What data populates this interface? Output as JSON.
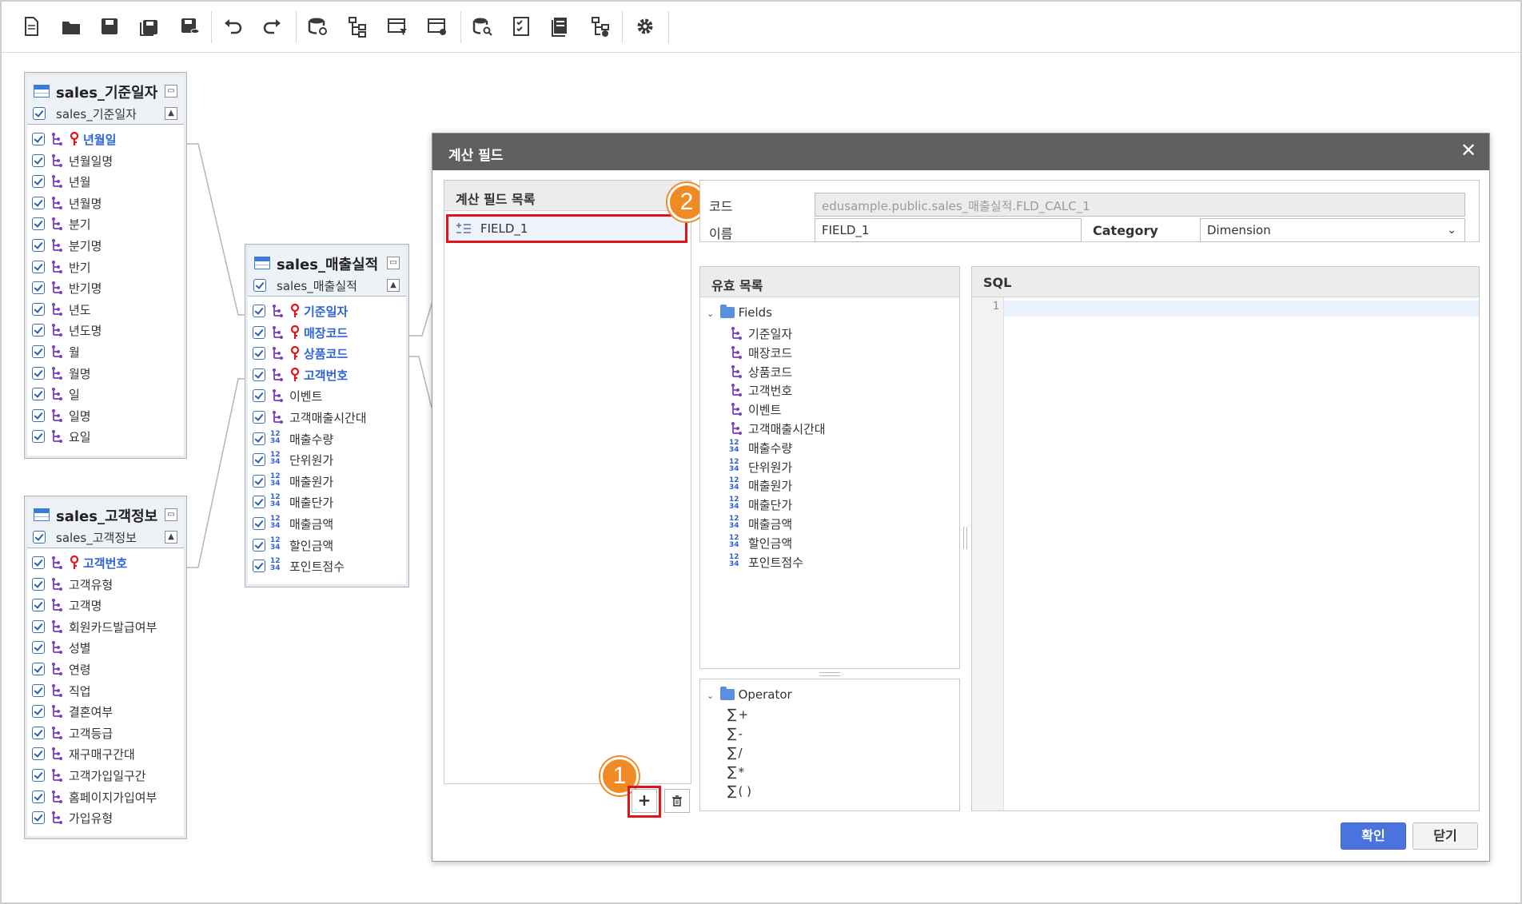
{
  "toolbar": {
    "buttons": [
      "new-icon",
      "open-folder-icon",
      "save-icon",
      "save-as-icon",
      "save-database-icon",
      "undo-icon",
      "redo-icon",
      "database-link-icon",
      "hierarchy-icon",
      "table-filter-icon",
      "table-settings-icon",
      "database-search-icon",
      "checklist-icon",
      "document-icon",
      "hierarchy-settings-icon",
      "gear-icon"
    ]
  },
  "entities": {
    "date": {
      "title": "sales_기준일자",
      "subtitle": "sales_기준일자",
      "fields": [
        {
          "label": "년월일",
          "key": true
        },
        {
          "label": "년월일명"
        },
        {
          "label": "년월"
        },
        {
          "label": "년월명"
        },
        {
          "label": "분기"
        },
        {
          "label": "분기명"
        },
        {
          "label": "반기"
        },
        {
          "label": "반기명"
        },
        {
          "label": "년도"
        },
        {
          "label": "년도명"
        },
        {
          "label": "월"
        },
        {
          "label": "월명"
        },
        {
          "label": "일"
        },
        {
          "label": "일명"
        },
        {
          "label": "요일"
        }
      ]
    },
    "customer": {
      "title": "sales_고객정보",
      "subtitle": "sales_고객정보",
      "fields": [
        {
          "label": "고객번호",
          "key": true
        },
        {
          "label": "고객유형"
        },
        {
          "label": "고객명"
        },
        {
          "label": "회원카드발급여부"
        },
        {
          "label": "성별"
        },
        {
          "label": "연령"
        },
        {
          "label": "직업"
        },
        {
          "label": "결혼여부"
        },
        {
          "label": "고객등급"
        },
        {
          "label": "재구매구간대"
        },
        {
          "label": "고객가입일구간"
        },
        {
          "label": "홈페이지가입여부"
        },
        {
          "label": "가입유형"
        }
      ]
    },
    "sales": {
      "title": "sales_매출실적",
      "subtitle": "sales_매출실적",
      "fields": [
        {
          "label": "기준일자",
          "key": true,
          "type": "dim"
        },
        {
          "label": "매장코드",
          "key": true,
          "type": "dim"
        },
        {
          "label": "상품코드",
          "key": true,
          "type": "dim"
        },
        {
          "label": "고객번호",
          "key": true,
          "type": "dim"
        },
        {
          "label": "이벤트",
          "type": "dim"
        },
        {
          "label": "고객매출시간대",
          "type": "dim"
        },
        {
          "label": "매출수량",
          "type": "num"
        },
        {
          "label": "단위원가",
          "type": "num"
        },
        {
          "label": "매출원가",
          "type": "num"
        },
        {
          "label": "매출단가",
          "type": "num"
        },
        {
          "label": "매출금액",
          "type": "num"
        },
        {
          "label": "할인금액",
          "type": "num"
        },
        {
          "label": "포인트점수",
          "type": "num"
        }
      ]
    }
  },
  "dialog": {
    "title": "계산 필드",
    "close": "✕",
    "calc_list": {
      "header": "계산 필드 목록",
      "items": [
        "FIELD_1"
      ]
    },
    "badges": {
      "one": "1",
      "two": "2"
    },
    "add_button": "+",
    "form": {
      "code_label": "코드",
      "code_value": "edusample.public.sales_매출실적.FLD_CALC_1",
      "name_label": "이름",
      "name_value": "FIELD_1",
      "category_label": "Category",
      "category_value": "Dimension"
    },
    "valid_list": {
      "header": "유효 목록",
      "folder": "Fields",
      "fields": [
        {
          "label": "기준일자",
          "type": "dim"
        },
        {
          "label": "매장코드",
          "type": "dim"
        },
        {
          "label": "상품코드",
          "type": "dim"
        },
        {
          "label": "고객번호",
          "type": "dim"
        },
        {
          "label": "이벤트",
          "type": "dim"
        },
        {
          "label": "고객매출시간대",
          "type": "dim"
        },
        {
          "label": "매출수량",
          "type": "num"
        },
        {
          "label": "단위원가",
          "type": "num"
        },
        {
          "label": "매출원가",
          "type": "num"
        },
        {
          "label": "매출단가",
          "type": "num"
        },
        {
          "label": "매출금액",
          "type": "num"
        },
        {
          "label": "할인금액",
          "type": "num"
        },
        {
          "label": "포인트점수",
          "type": "num"
        }
      ]
    },
    "operators": {
      "folder": "Operator",
      "items": [
        "+",
        "-",
        "/",
        "*",
        "( )"
      ],
      "symbol": "∑"
    },
    "sql": {
      "header": "SQL",
      "line_number": "1"
    },
    "ok_label": "확인",
    "close_label": "닫기"
  },
  "colors": {
    "accent": "#4a73e0",
    "highlight": "#e3131b",
    "badge": "#f08a24",
    "key_text": "#2f62d6",
    "dim_icon": "#7a3fc4"
  }
}
